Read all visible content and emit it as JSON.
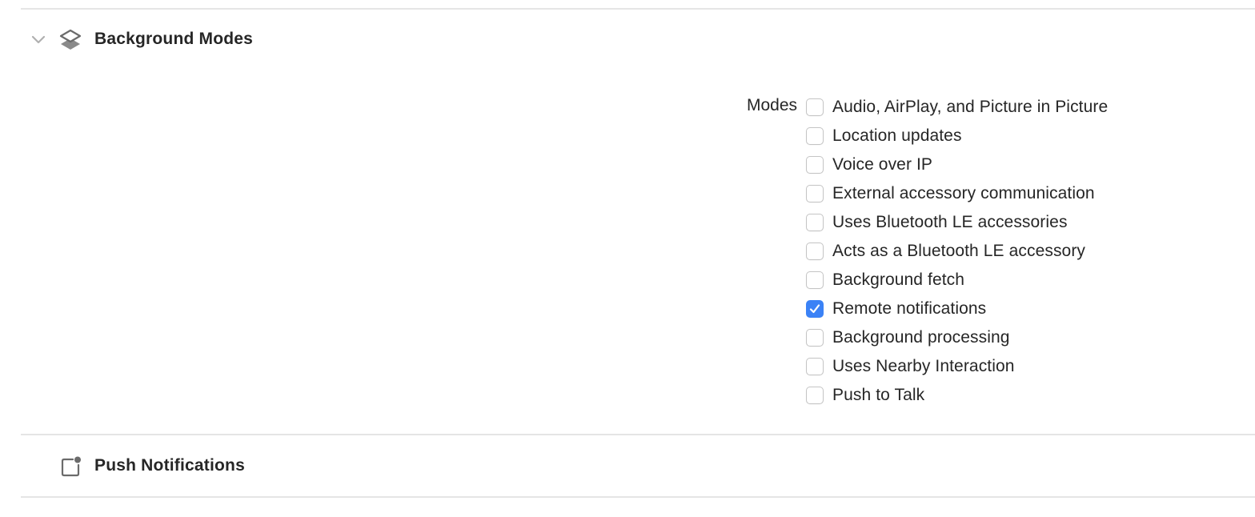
{
  "sections": {
    "background_modes": {
      "title": "Background Modes",
      "icon": "layers-icon",
      "expanded": true,
      "modes_label": "Modes",
      "modes": [
        {
          "label": "Audio, AirPlay, and Picture in Picture",
          "checked": false
        },
        {
          "label": "Location updates",
          "checked": false
        },
        {
          "label": "Voice over IP",
          "checked": false
        },
        {
          "label": "External accessory communication",
          "checked": false
        },
        {
          "label": "Uses Bluetooth LE accessories",
          "checked": false
        },
        {
          "label": "Acts as a Bluetooth LE accessory",
          "checked": false
        },
        {
          "label": "Background fetch",
          "checked": false
        },
        {
          "label": "Remote notifications",
          "checked": true
        },
        {
          "label": "Background processing",
          "checked": false
        },
        {
          "label": "Uses Nearby Interaction",
          "checked": false
        },
        {
          "label": "Push to Talk",
          "checked": false
        }
      ]
    },
    "push_notifications": {
      "title": "Push Notifications",
      "icon": "notification-badge-icon"
    }
  },
  "colors": {
    "accent": "#3b82f6",
    "text": "#262626",
    "divider": "#e5e5e5",
    "icon": "#6b6b6b"
  }
}
